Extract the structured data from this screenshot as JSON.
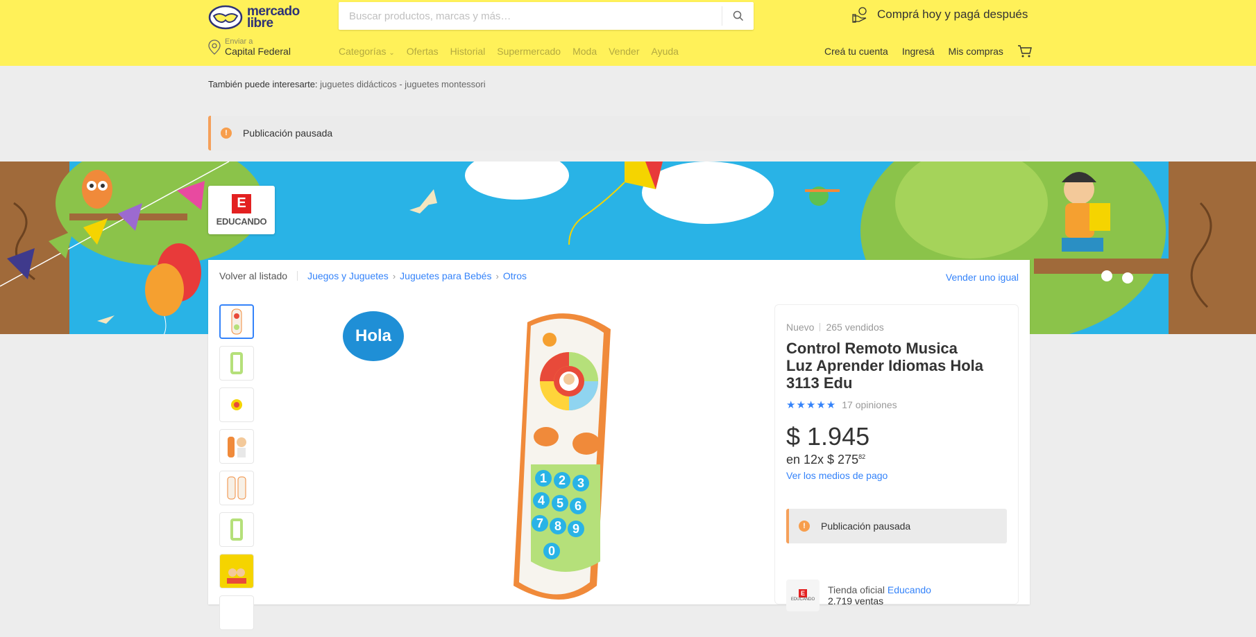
{
  "header": {
    "logo_line1": "mercado",
    "logo_line2": "libre",
    "search_placeholder": "Buscar productos, marcas y más…",
    "promo": "Comprá hoy y pagá después",
    "location_label": "Enviar a",
    "location_value": "Capital Federal",
    "nav": [
      "Categorías",
      "Ofertas",
      "Historial",
      "Supermercado",
      "Moda",
      "Vender",
      "Ayuda"
    ],
    "account": {
      "create": "Creá tu cuenta",
      "login": "Ingresá",
      "purchases": "Mis compras"
    }
  },
  "also_interest": {
    "label": "También puede interesarte:",
    "links": "juguetes didácticos - juguetes montessori"
  },
  "alert": {
    "text": "Publicación pausada",
    "icon": "!"
  },
  "store": {
    "letter": "E",
    "name": "EDUCANDO"
  },
  "breadcrumb": {
    "back": "Volver al listado",
    "items": [
      "Juegos y Juguetes",
      "Juguetes para Bebés",
      "Otros"
    ],
    "chevron": "›",
    "sell": "Vender uno igual"
  },
  "product": {
    "condition": "Nuevo",
    "sold": "265 vendidos",
    "title": "Control Remoto Musica Luz Aprender Idiomas Hola 3113 Edu",
    "stars": "★★★★★",
    "reviews": "17 opiniones",
    "price": "$ 1.945",
    "installments_prefix": "en 12x $ 275",
    "installments_cents": "82",
    "payment_link": "Ver los medios de pago",
    "paused": "Publicación pausada",
    "brand_logo": "Hola",
    "keypad": [
      "1",
      "2",
      "3",
      "4",
      "5",
      "6",
      "7",
      "8",
      "9",
      "0"
    ]
  },
  "seller": {
    "label": "Tienda oficial",
    "name": "Educando",
    "sales": "2.719 ventas",
    "letter": "E",
    "logo_name": "EDUCANDO"
  },
  "colors": {
    "header": "#fff159",
    "link": "#3483fa",
    "alert_border": "#f5a05a"
  }
}
